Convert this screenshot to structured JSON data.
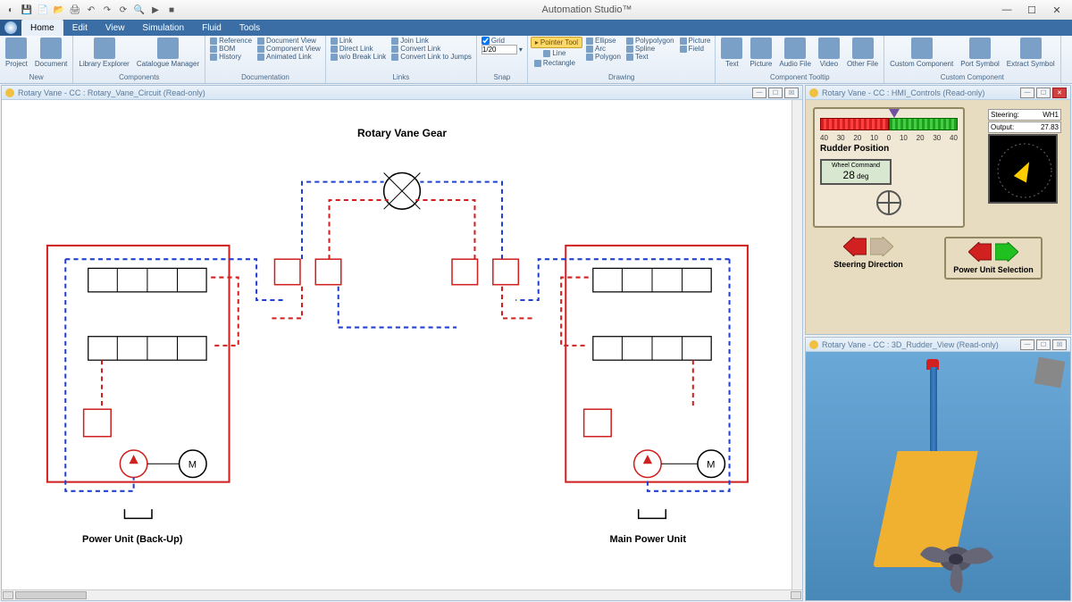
{
  "app": {
    "title": "Automation Studio™"
  },
  "menu": {
    "tabs": [
      "Home",
      "Edit",
      "View",
      "Simulation",
      "Fluid",
      "Tools"
    ],
    "active": 0
  },
  "ribbon": {
    "groups": [
      {
        "label": "New",
        "items_big": [
          {
            "label": "Project"
          },
          {
            "label": "Document"
          }
        ]
      },
      {
        "label": "Components",
        "items_big": [
          {
            "label": "Library Explorer"
          },
          {
            "label": "Catalogue Manager"
          }
        ]
      },
      {
        "label": "Documentation",
        "list": [
          "Reference",
          "BOM",
          "History",
          "Document View",
          "Component View",
          "Animated Link"
        ]
      },
      {
        "label": "Links",
        "list": [
          "Link",
          "Direct Link",
          "w/o Break Link",
          "Join Link",
          "Convert Link",
          "Convert Link to Jumps"
        ]
      },
      {
        "label": "Snap",
        "grid_label": "Grid",
        "grid_value": "1/20"
      },
      {
        "label": "Drawing",
        "pointer": "Pointer Tool",
        "list": [
          "Ellipse",
          "Line",
          "Rectangle",
          "Polypolygon",
          "Arc",
          "Polygon",
          "Picture",
          "Spline",
          "Text",
          "Field"
        ]
      },
      {
        "label": "Component Tooltip",
        "items_big": [
          {
            "label": "Text"
          },
          {
            "label": "Picture"
          },
          {
            "label": "Audio File"
          },
          {
            "label": "Video"
          },
          {
            "label": "Other File"
          }
        ]
      },
      {
        "label": "Custom Component",
        "items_big": [
          {
            "label": "Custom Component"
          },
          {
            "label": "Port Symbol"
          },
          {
            "label": "Extract Symbol"
          }
        ]
      }
    ]
  },
  "panels": {
    "circuit": {
      "title": "Rotary Vane - CC : Rotary_Vane_Circuit (Read-only)"
    },
    "hmi": {
      "title": "Rotary Vane - CC : HMI_Controls (Read-only)"
    },
    "view3d": {
      "title": "Rotary Vane - CC : 3D_Rudder_View (Read-only)"
    }
  },
  "circuit": {
    "title": "Rotary Vane Gear",
    "left_unit": "Power Unit (Back-Up)",
    "right_unit": "Main Power Unit"
  },
  "hmi": {
    "scale_ticks": [
      "40",
      "30",
      "20",
      "10",
      "0",
      "10",
      "20",
      "30",
      "40"
    ],
    "rudder_label": "Rudder Position",
    "wheel_cmd_label": "Wheel Command",
    "wheel_cmd_value": "28",
    "wheel_cmd_unit": "deg",
    "steering_row_label": "Steering:",
    "steering_row_value": "WH1",
    "output_label": "Output:",
    "output_value": "27.83",
    "steering_dir_label": "Steering Direction",
    "power_unit_label": "Power Unit Selection"
  }
}
